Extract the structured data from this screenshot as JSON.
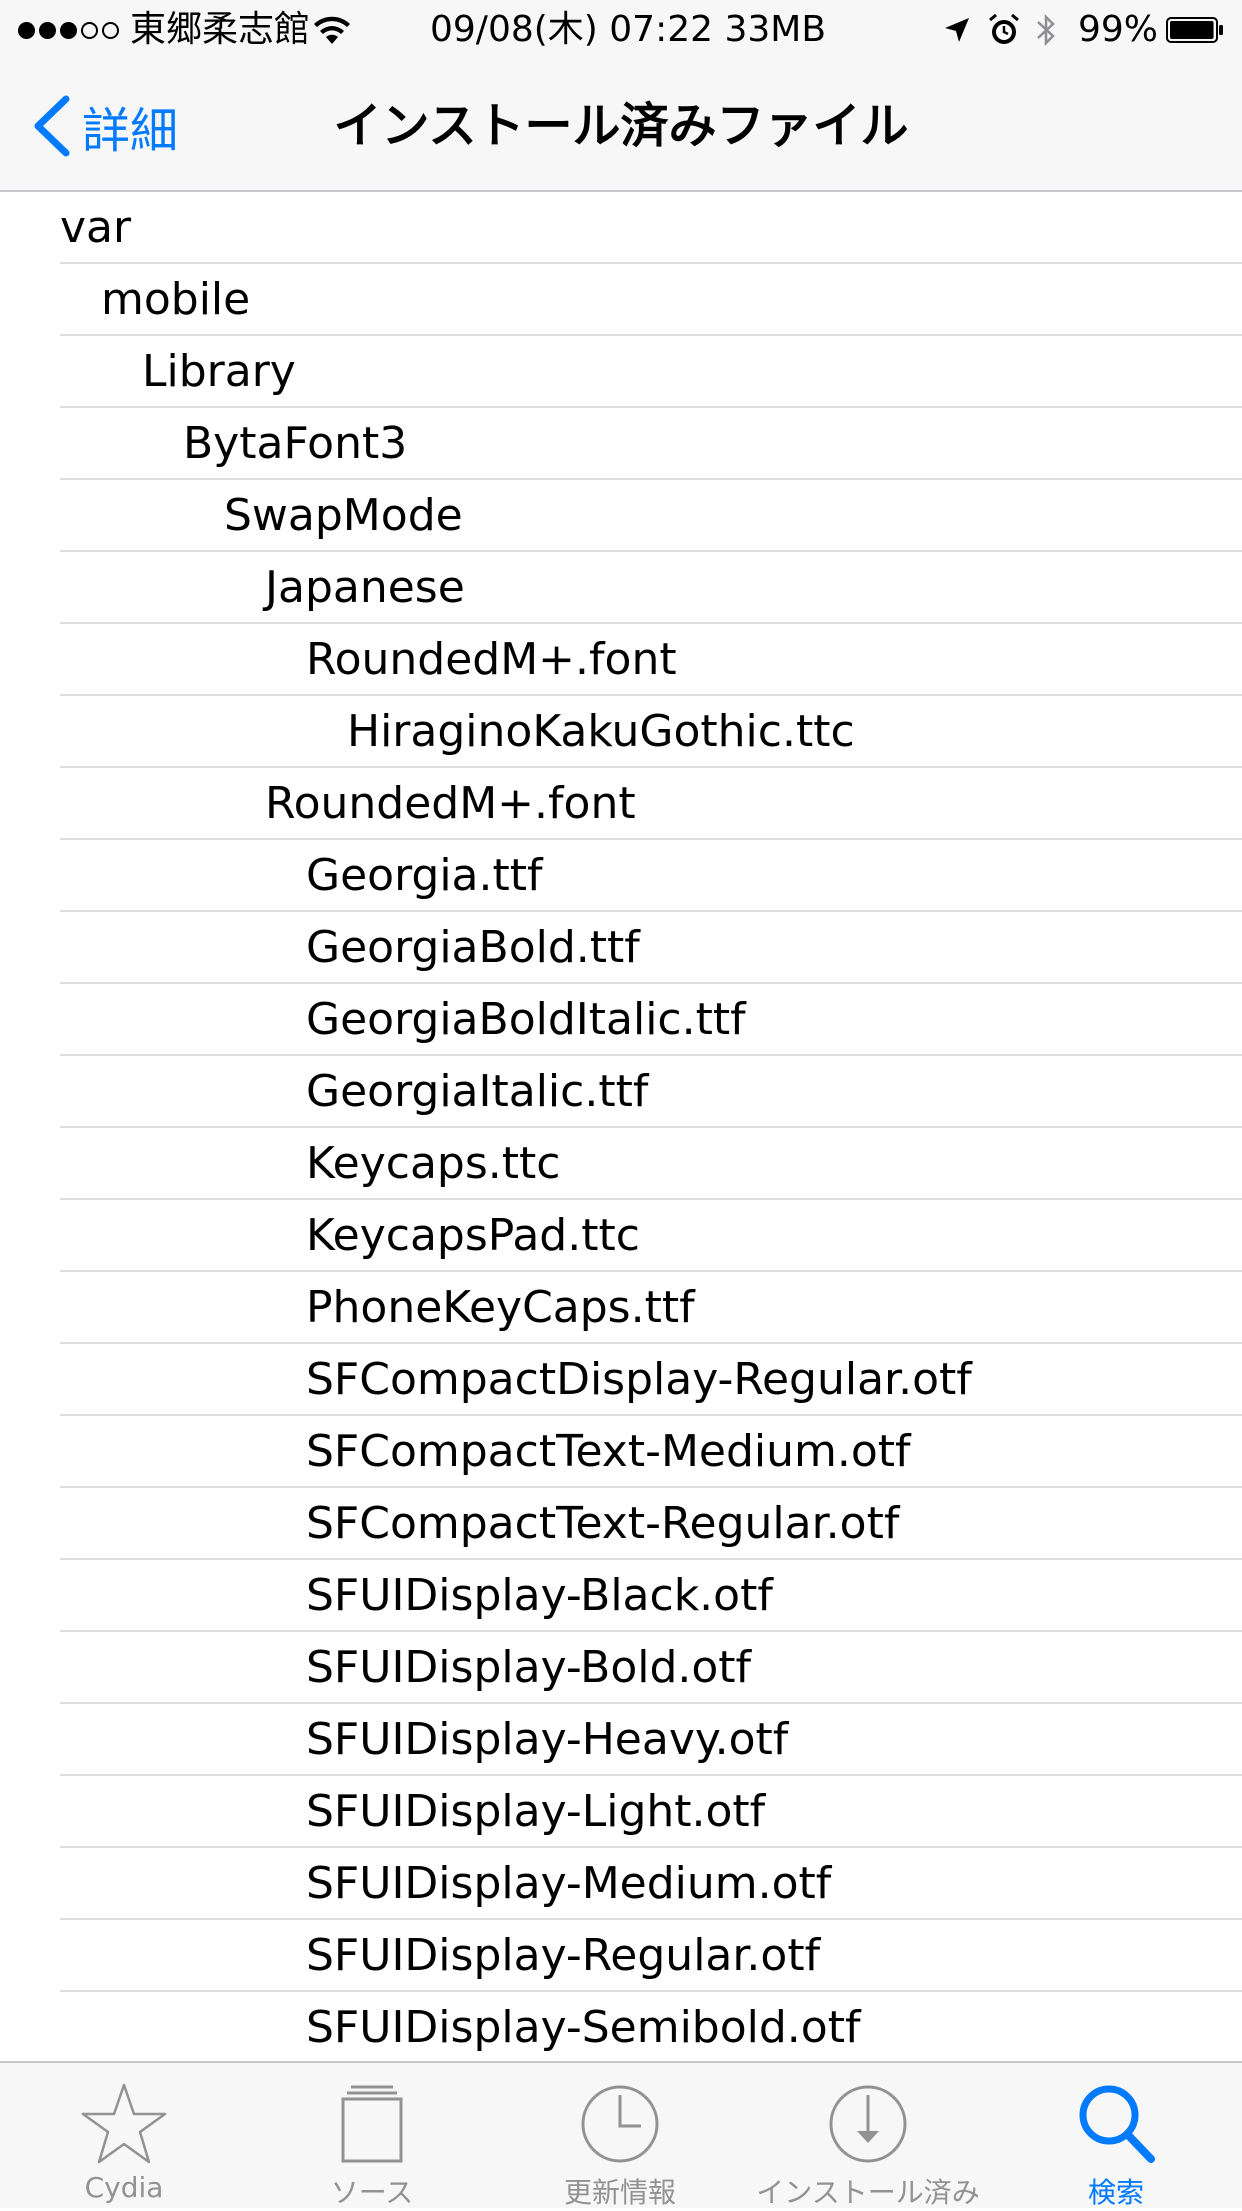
{
  "status_bar": {
    "signal_dots": [
      "full",
      "full",
      "full",
      "empty",
      "empty"
    ],
    "carrier": "東郷柔志館",
    "datetime": "09/08(木) 07:22 33MB",
    "battery_percent": "99%",
    "battery_level": 0.99
  },
  "nav": {
    "back_label": "詳細",
    "title": "インストール済みファイル"
  },
  "files": [
    {
      "name": "var",
      "depth": 0
    },
    {
      "name": "mobile",
      "depth": 1
    },
    {
      "name": "Library",
      "depth": 2
    },
    {
      "name": "BytaFont3",
      "depth": 3
    },
    {
      "name": "SwapMode",
      "depth": 4
    },
    {
      "name": "Japanese",
      "depth": 5
    },
    {
      "name": "RoundedM+.font",
      "depth": 6
    },
    {
      "name": "HiraginoKakuGothic.ttc",
      "depth": 7
    },
    {
      "name": "RoundedM+.font",
      "depth": 5
    },
    {
      "name": "Georgia.ttf",
      "depth": 6
    },
    {
      "name": "GeorgiaBold.ttf",
      "depth": 6
    },
    {
      "name": "GeorgiaBoldItalic.ttf",
      "depth": 6
    },
    {
      "name": "GeorgiaItalic.ttf",
      "depth": 6
    },
    {
      "name": "Keycaps.ttc",
      "depth": 6
    },
    {
      "name": "KeycapsPad.ttc",
      "depth": 6
    },
    {
      "name": "PhoneKeyCaps.ttf",
      "depth": 6
    },
    {
      "name": "SFCompactDisplay-Regular.otf",
      "depth": 6
    },
    {
      "name": "SFCompactText-Medium.otf",
      "depth": 6
    },
    {
      "name": "SFCompactText-Regular.otf",
      "depth": 6
    },
    {
      "name": "SFUIDisplay-Black.otf",
      "depth": 6
    },
    {
      "name": "SFUIDisplay-Bold.otf",
      "depth": 6
    },
    {
      "name": "SFUIDisplay-Heavy.otf",
      "depth": 6
    },
    {
      "name": "SFUIDisplay-Light.otf",
      "depth": 6
    },
    {
      "name": "SFUIDisplay-Medium.otf",
      "depth": 6
    },
    {
      "name": "SFUIDisplay-Regular.otf",
      "depth": 6
    },
    {
      "name": "SFUIDisplay-Semibold.otf",
      "depth": 6
    }
  ],
  "tabs": [
    {
      "label": "Cydia",
      "icon": "star-icon",
      "active": false
    },
    {
      "label": "ソース",
      "icon": "sources-icon",
      "active": false
    },
    {
      "label": "更新情報",
      "icon": "clock-icon",
      "active": false
    },
    {
      "label": "インストール済み",
      "icon": "download-icon",
      "active": false
    },
    {
      "label": "検索",
      "icon": "search-icon",
      "active": true
    }
  ],
  "colors": {
    "accent": "#007aff",
    "inactive": "#929292",
    "separator": "#dddddd",
    "bar_background": "#f7f7f7"
  }
}
